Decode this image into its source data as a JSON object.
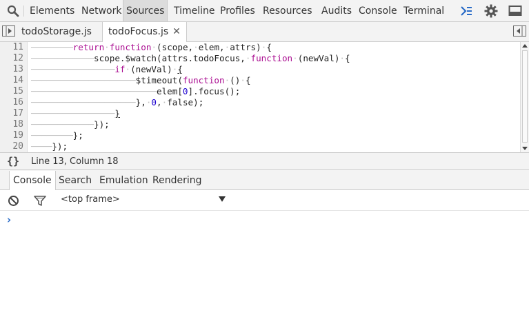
{
  "toolbar": {
    "tabs": [
      {
        "label": "Elements"
      },
      {
        "label": "Network"
      },
      {
        "label": "Sources",
        "selected": true
      },
      {
        "label": "Timeline"
      },
      {
        "label": "Profiles"
      },
      {
        "label": "Resources"
      },
      {
        "label": "Audits"
      },
      {
        "label": "Console"
      },
      {
        "label": "Terminal"
      }
    ],
    "icons": [
      "search-icon",
      "console-drawer-icon",
      "gear-icon",
      "dock-icon"
    ]
  },
  "editor_tabs": {
    "files": [
      {
        "label": "todoStorage.js",
        "active": false
      },
      {
        "label": "todoFocus.js",
        "active": true,
        "close": "✕"
      }
    ]
  },
  "editor": {
    "line_numbers": [
      "11",
      "12",
      "13",
      "14",
      "15",
      "16",
      "17",
      "18",
      "19",
      "20"
    ]
  },
  "status_bar": {
    "pretty_print": "{}",
    "position": "Line 13, Column 18"
  },
  "drawer": {
    "tabs": [
      {
        "label": "Console",
        "active": true
      },
      {
        "label": "Search"
      },
      {
        "label": "Emulation"
      },
      {
        "label": "Rendering"
      }
    ]
  },
  "console": {
    "frame": "<top frame>",
    "prompt": "›"
  },
  "colors": {
    "keyword": "#aa0d91",
    "number": "#1c00cf",
    "prompt": "#2a6cc7",
    "accent": "#2a6cc7"
  }
}
